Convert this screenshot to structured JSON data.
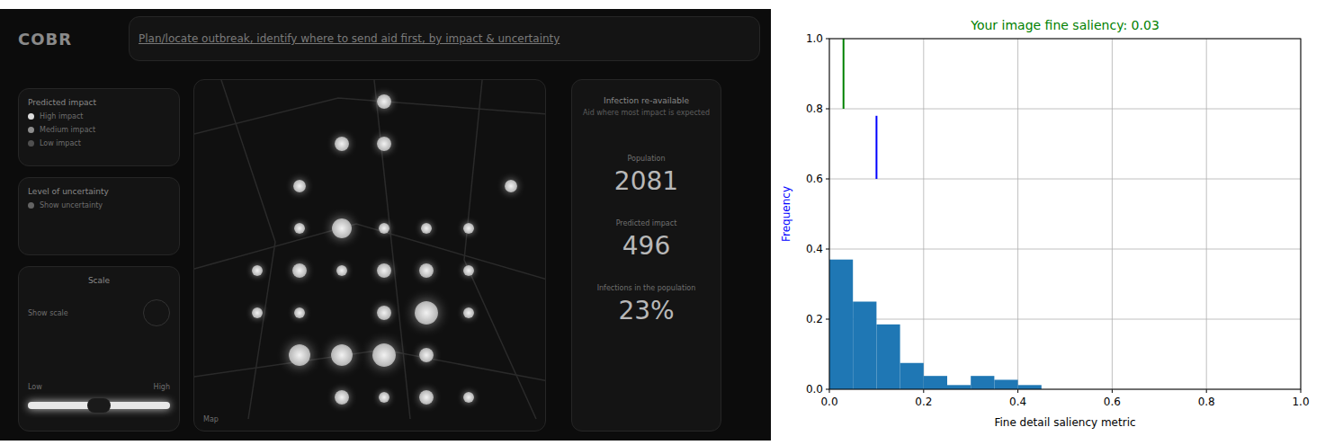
{
  "dashboard": {
    "logo": "COBR",
    "title": "Plan/locate outbreak, identify where to send aid first, by impact & uncertainty",
    "panels": [
      {
        "title": "Predicted impact",
        "items": [
          {
            "label": "High impact",
            "level": 1
          },
          {
            "label": "Medium impact",
            "level": 0.6
          },
          {
            "label": "Low impact",
            "level": 0.3
          }
        ]
      },
      {
        "title": "Level of uncertainty",
        "items": [
          {
            "label": "Show uncertainty",
            "level": 0.4
          }
        ]
      }
    ],
    "scale": {
      "title": "Scale",
      "toggle": "Show scale",
      "low": "Low",
      "high": "High",
      "level": 0.5
    },
    "map": {
      "label": "Map",
      "cells": [
        [
          0,
          0,
          0,
          0.5,
          0,
          0,
          0
        ],
        [
          0,
          0,
          0.5,
          0.5,
          0,
          0,
          0
        ],
        [
          0,
          0.4,
          0,
          0,
          0,
          0,
          0.4
        ],
        [
          0,
          0.3,
          0.8,
          0.3,
          0.3,
          0.3,
          0
        ],
        [
          0.3,
          0.5,
          0.3,
          0.5,
          0.5,
          0.3,
          0
        ],
        [
          0.3,
          0.3,
          0,
          0.5,
          1,
          0.3,
          0
        ],
        [
          0,
          0.9,
          0.9,
          1,
          0.5,
          0,
          0
        ],
        [
          0,
          0,
          0.5,
          0.3,
          0.5,
          0.3,
          0
        ]
      ]
    },
    "stats": {
      "title": "Infection re-available",
      "subtitle": "Aid where most impact is expected",
      "items": [
        {
          "label": "Population",
          "value": "2081"
        },
        {
          "label": "Predicted impact",
          "value": "496"
        },
        {
          "label": "Infections in the population",
          "value": "23%"
        }
      ]
    }
  },
  "chart": {
    "title": "Your image fine saliency: 0.03",
    "x_label": "Fine detail saliency metric",
    "y_label": "Frequency",
    "x_ticks": [
      "0.0",
      "0.2",
      "0.4",
      "0.6",
      "0.8",
      "1.0"
    ],
    "y_ticks": [
      "0.0",
      "0.2",
      "0.4",
      "0.6",
      "0.8",
      "1.0"
    ],
    "bin_width": 0.05,
    "series": [
      {
        "name": "histogram",
        "color": "#1f77b4",
        "values": [
          0.37,
          0.25,
          0.185,
          0.075,
          0.038,
          0.012,
          0.038,
          0.027,
          0.012
        ]
      }
    ],
    "markers": [
      {
        "name": "your image",
        "value": 0.03,
        "from": 0.8,
        "to": 1.0,
        "color": "#008000"
      },
      {
        "name": "reference",
        "value": 0.1,
        "from": 0.6,
        "to": 0.78,
        "color": "#0000ff"
      }
    ]
  }
}
